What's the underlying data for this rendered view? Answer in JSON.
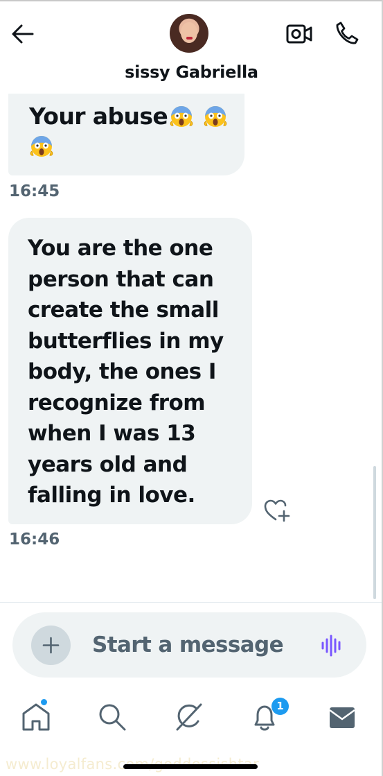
{
  "header": {
    "contact_name": "sissy Gabriella",
    "back_icon": "arrow-left-icon",
    "video_icon": "video-call-icon",
    "call_icon": "phone-icon"
  },
  "messages": [
    {
      "text": "Your abuse",
      "emoji": [
        "😱",
        "😱",
        "😱"
      ],
      "timestamp": "16:45"
    },
    {
      "text": "You are the one person that can create the small butterflies in my body, the ones I recognize from when I was 13 years old and falling in love.",
      "timestamp": "16:46"
    }
  ],
  "composer": {
    "placeholder": "Start a message",
    "add_icon": "plus-icon",
    "voice_icon": "voice-waveform-icon"
  },
  "bottom_nav": {
    "items": [
      "home-icon",
      "search-icon",
      "grok-icon",
      "notifications-icon",
      "messages-icon"
    ],
    "notifications_badge": "1"
  },
  "watermark": "www.loyalfans.com/goddessishtar",
  "colors": {
    "accent": "#1d9bf0",
    "bubble": "#eff3f4",
    "text": "#0f1419",
    "muted": "#536471",
    "voice": "#7856ff"
  }
}
